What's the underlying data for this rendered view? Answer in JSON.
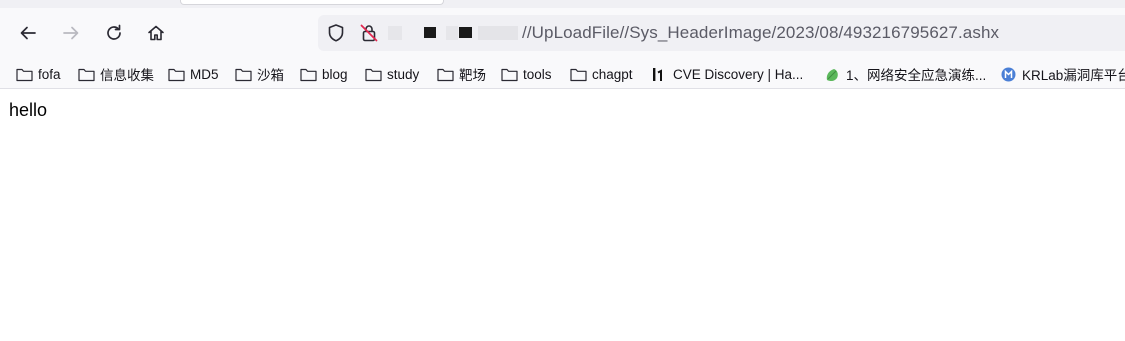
{
  "navigation": {
    "back_icon": "arrow-left-icon",
    "forward_icon": "arrow-right-icon",
    "reload_icon": "reload-icon",
    "home_icon": "home-icon"
  },
  "urlbar": {
    "shield_icon": "tracking-shield-icon",
    "lock_icon": "insecure-lock-icon",
    "url_visible": "//UpLoadFile//Sys_HeaderImage/2023/08/493216795627.ashx"
  },
  "bookmarks": [
    {
      "label": "fofa",
      "icon": "folder-icon"
    },
    {
      "label": "信息收集",
      "icon": "folder-icon"
    },
    {
      "label": "MD5",
      "icon": "folder-icon"
    },
    {
      "label": "沙箱",
      "icon": "folder-icon"
    },
    {
      "label": "blog",
      "icon": "folder-icon"
    },
    {
      "label": "study",
      "icon": "folder-icon"
    },
    {
      "label": "靶场",
      "icon": "folder-icon"
    },
    {
      "label": "tools",
      "icon": "folder-icon"
    },
    {
      "label": "chagpt",
      "icon": "folder-icon"
    },
    {
      "label": "CVE Discovery | Ha...",
      "icon": "site-favicon-icon"
    },
    {
      "label": "1、网络安全应急演练...",
      "icon": "site-favicon-icon"
    },
    {
      "label": "KRLab漏洞库平台",
      "icon": "site-favicon-icon"
    }
  ],
  "page": {
    "body_text": "hello"
  }
}
